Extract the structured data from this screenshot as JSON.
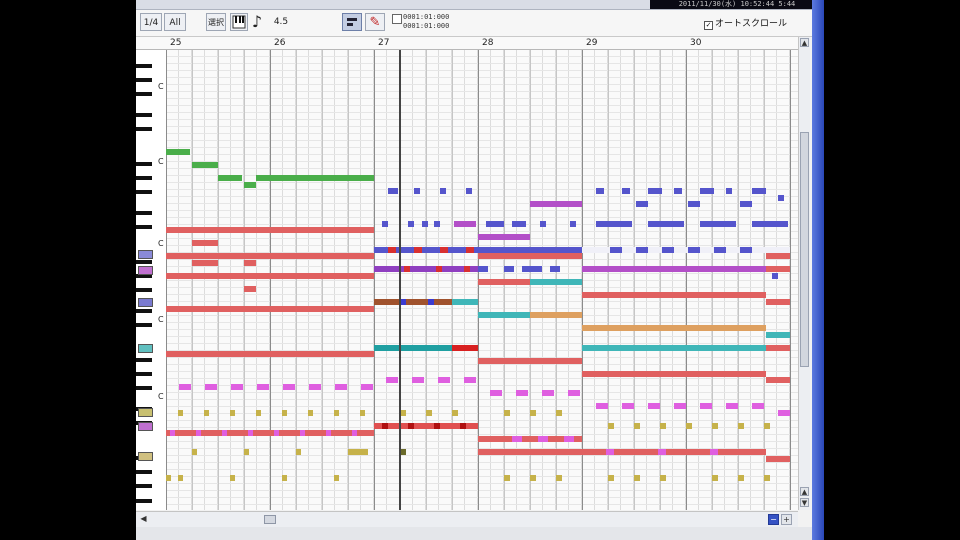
{
  "window": {
    "clock_text": "2011/11/30(水) 10:52:44 5:44",
    "toolbar": {
      "quantize_label": "1/4",
      "length_label": "All",
      "edit_mode_label": "選択",
      "note_glyph": "♪",
      "note_value": "4.5",
      "draw_mode_glyph": "✎",
      "position_line1": "0001:01:000",
      "position_line2": "0001:01:000",
      "autoscroll_label": "オートスクロール",
      "autoscroll_checked": true
    },
    "ruler": {
      "measures": [
        "25",
        "26",
        "27",
        "28",
        "29",
        "30"
      ]
    },
    "scroll": {
      "up_arrow": "▲",
      "down_arrow": "▼",
      "left_arrow": "◀",
      "right_arrow": "▶",
      "zoom_out": "−",
      "zoom_in": "+"
    },
    "keyboard": {
      "octave_labels": [
        "C",
        "C",
        "C",
        "C",
        "C"
      ]
    },
    "colors": {
      "green": "#4aae4a",
      "red": "#e06060",
      "blue": "#5555cc",
      "purple": "#b34fc8",
      "magenta": "#df5fe0",
      "cyan": "#3fb6b8",
      "orange": "#dea060",
      "olive": "#c6b24a",
      "accent": "#3552c4"
    }
  }
}
